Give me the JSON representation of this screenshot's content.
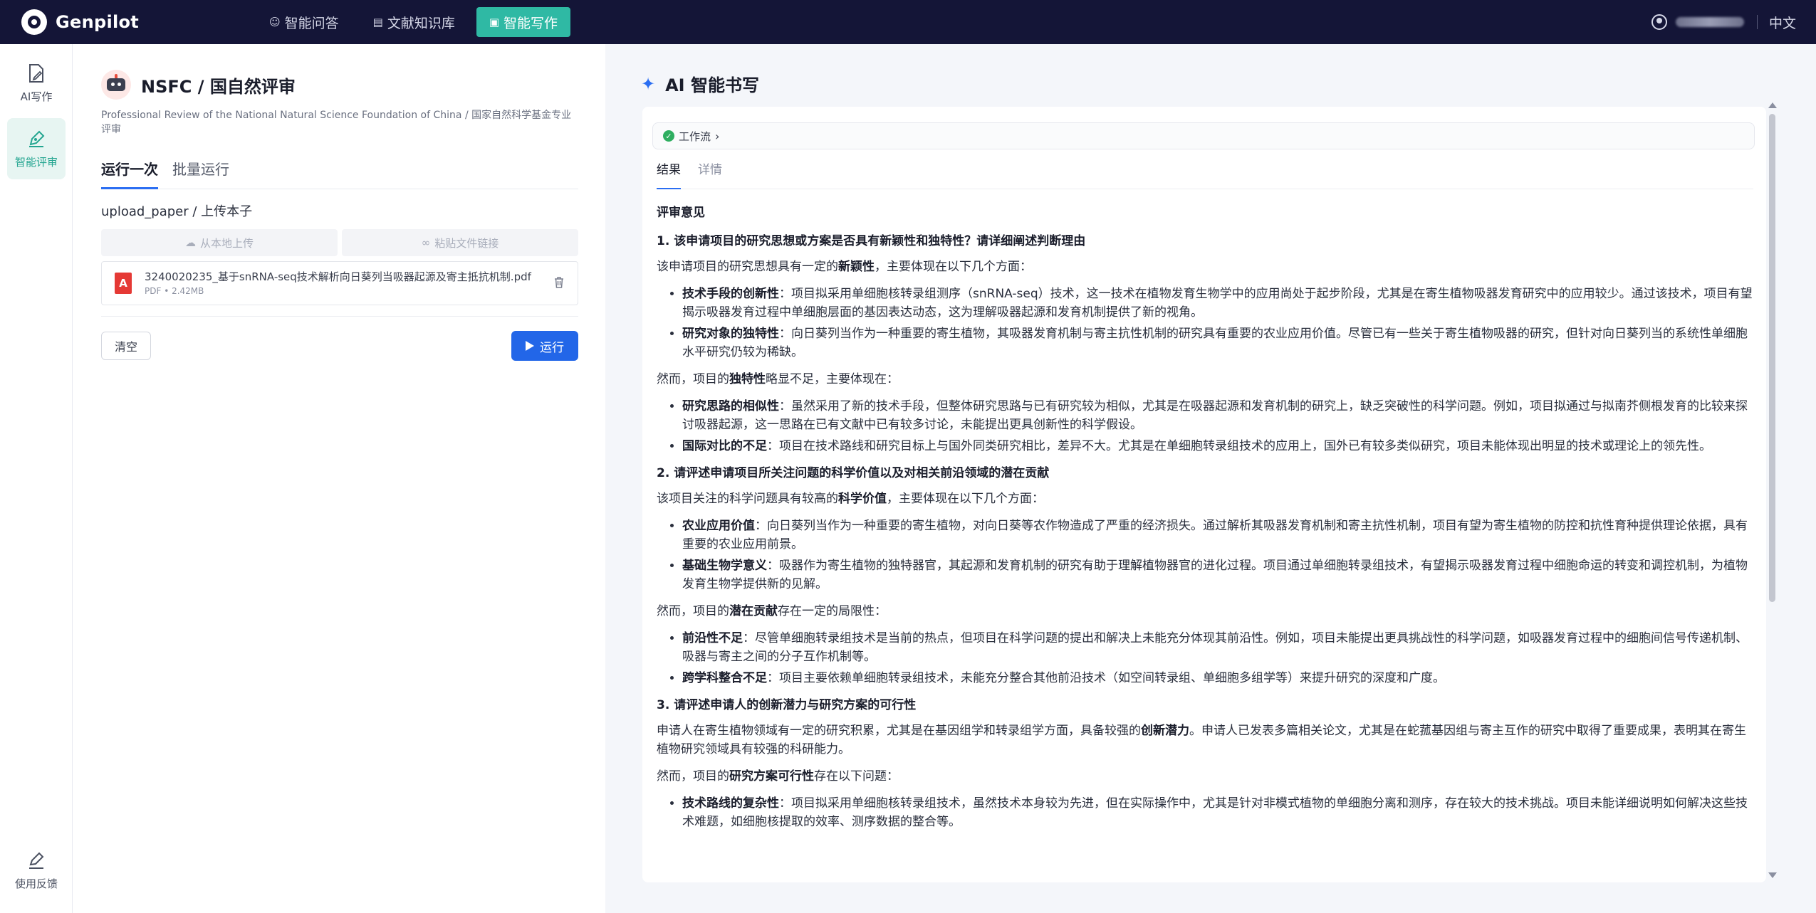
{
  "app": {
    "brand": "Genpilot",
    "nav": [
      {
        "label": "智能问答",
        "icon": "chat-icon"
      },
      {
        "label": "文献知识库",
        "icon": "library-icon"
      },
      {
        "label": "智能写作",
        "icon": "write-icon"
      }
    ],
    "language": "中文"
  },
  "rail": {
    "items": [
      {
        "label": "AI写作"
      },
      {
        "label": "智能评审"
      }
    ],
    "feedback": "使用反馈"
  },
  "left": {
    "title": "NSFC / 国自然评审",
    "description": "Professional Review of the National Natural Science Foundation of China / 国家自然科学基金专业评审",
    "tabs": [
      "运行一次",
      "批量运行"
    ],
    "upload_label": "upload_paper / 上传本子",
    "upload_local": "从本地上传",
    "paste_link": "粘贴文件链接",
    "file": {
      "name": "3240020235_基于snRNA-seq技术解析向日葵列当吸器起源及寄主抵抗机制.pdf",
      "meta": "PDF • 2.42MB",
      "type_badge": "A"
    },
    "clear": "清空",
    "run": "运行"
  },
  "right": {
    "title": "AI 智能书写",
    "workflow": "工作流",
    "tabs": [
      "结果",
      "详情"
    ],
    "heading": "评审意见",
    "s1": {
      "title": "1. 该申请项目的研究思想或方案是否具有新颖性和独特性？请详细阐述判断理由",
      "p1_pre": "该申请项目的研究思想具有一定的",
      "p1_b": "新颖性",
      "p1_post": "，主要体现在以下几个方面：",
      "li1_b": "技术手段的创新性",
      "li1": "：项目拟采用单细胞核转录组测序（snRNA-seq）技术，这一技术在植物发育生物学中的应用尚处于起步阶段，尤其是在寄生植物吸器发育研究中的应用较少。通过该技术，项目有望揭示吸器发育过程中单细胞层面的基因表达动态，这为理解吸器起源和发育机制提供了新的视角。",
      "li2_b": "研究对象的独特性",
      "li2": "：向日葵列当作为一种重要的寄生植物，其吸器发育机制与寄主抗性机制的研究具有重要的农业应用价值。尽管已有一些关于寄生植物吸器的研究，但针对向日葵列当的系统性单细胞水平研究仍较为稀缺。",
      "p2_pre": "然而，项目的",
      "p2_b": "独特性",
      "p2_post": "略显不足，主要体现在：",
      "li3_b": "研究思路的相似性",
      "li3": "：虽然采用了新的技术手段，但整体研究思路与已有研究较为相似，尤其是在吸器起源和发育机制的研究上，缺乏突破性的科学问题。例如，项目拟通过与拟南芥侧根发育的比较来探讨吸器起源，这一思路在已有文献中已有较多讨论，未能提出更具创新性的科学假设。",
      "li4_b": "国际对比的不足",
      "li4": "：项目在技术路线和研究目标上与国外同类研究相比，差异不大。尤其是在单细胞转录组技术的应用上，国外已有较多类似研究，项目未能体现出明显的技术或理论上的领先性。"
    },
    "s2": {
      "title": "2. 请评述申请项目所关注问题的科学价值以及对相关前沿领域的潜在贡献",
      "p1_pre": "该项目关注的科学问题具有较高的",
      "p1_b": "科学价值",
      "p1_post": "，主要体现在以下几个方面：",
      "li1_b": "农业应用价值",
      "li1": "：向日葵列当作为一种重要的寄生植物，对向日葵等农作物造成了严重的经济损失。通过解析其吸器发育机制和寄主抗性机制，项目有望为寄生植物的防控和抗性育种提供理论依据，具有重要的农业应用前景。",
      "li2_b": "基础生物学意义",
      "li2": "：吸器作为寄生植物的独特器官，其起源和发育机制的研究有助于理解植物器官的进化过程。项目通过单细胞转录组技术，有望揭示吸器发育过程中细胞命运的转变和调控机制，为植物发育生物学提供新的见解。",
      "p2_pre": "然而，项目的",
      "p2_b": "潜在贡献",
      "p2_post": "存在一定的局限性：",
      "li3_b": "前沿性不足",
      "li3": "：尽管单细胞转录组技术是当前的热点，但项目在科学问题的提出和解决上未能充分体现其前沿性。例如，项目未能提出更具挑战性的科学问题，如吸器发育过程中的细胞间信号传递机制、吸器与寄主之间的分子互作机制等。",
      "li4_b": "跨学科整合不足",
      "li4": "：项目主要依赖单细胞转录组技术，未能充分整合其他前沿技术（如空间转录组、单细胞多组学等）来提升研究的深度和广度。"
    },
    "s3": {
      "title": "3. 请评述申请人的创新潜力与研究方案的可行性",
      "p1_pre": "申请人在寄生植物领域有一定的研究积累，尤其是在基因组学和转录组学方面，具备较强的",
      "p1_b": "创新潜力",
      "p1_post": "。申请人已发表多篇相关论文，尤其是在蛇菰基因组与寄主互作的研究中取得了重要成果，表明其在寄生植物研究领域具有较强的科研能力。",
      "p2_pre": "然而，项目的",
      "p2_b": "研究方案可行性",
      "p2_post": "存在以下问题：",
      "li1_b": "技术路线的复杂性",
      "li1": "：项目拟采用单细胞核转录组技术，虽然技术本身较为先进，但在实际操作中，尤其是针对非模式植物的单细胞分离和测序，存在较大的技术挑战。项目未能详细说明如何解决这些技术难题，如细胞核提取的效率、测序数据的整合等。"
    }
  }
}
